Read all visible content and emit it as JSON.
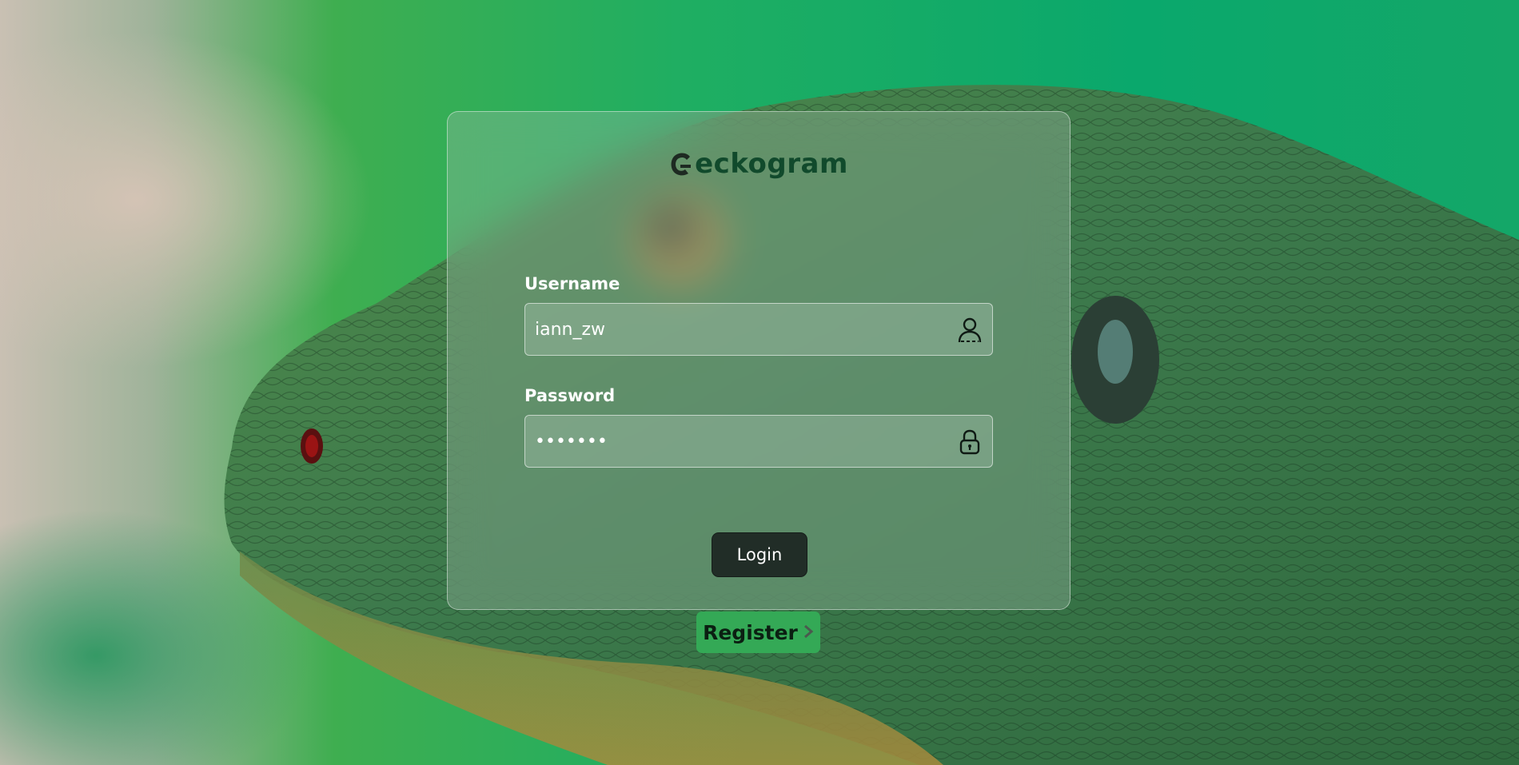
{
  "app": {
    "brand": "eckogram",
    "brand_mark": "gecko-logo-icon"
  },
  "form": {
    "username": {
      "label": "Username",
      "value": "iann_zw",
      "icon": "user-icon"
    },
    "password": {
      "label": "Password",
      "value": "•••••••",
      "icon": "lock-icon"
    },
    "login_label": "Login",
    "register_label": "Register",
    "register_icon": "chevron-right-icon"
  },
  "colors": {
    "brand": "#114a2c",
    "login_button": "#212d27",
    "register_button": "#34a956",
    "background_green": "#0aa86c"
  }
}
